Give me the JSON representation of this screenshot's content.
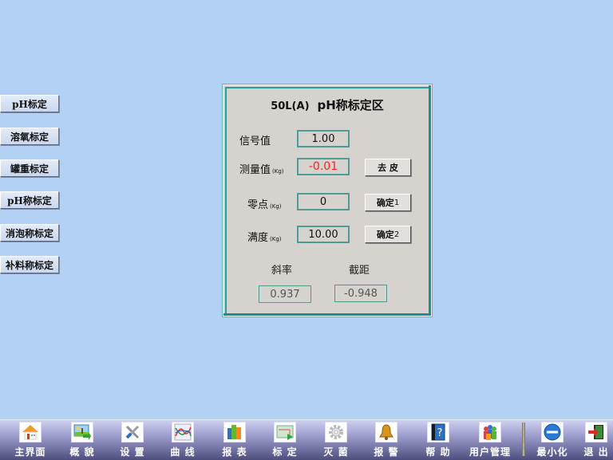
{
  "sidebar": {
    "items": [
      {
        "label": "pH标定"
      },
      {
        "label": "溶氧标定"
      },
      {
        "label": "罐重标定"
      },
      {
        "label": "pH称标定"
      },
      {
        "label": "消泡称标定"
      },
      {
        "label": "补料称标定"
      }
    ]
  },
  "panel": {
    "model": "50L(A)",
    "title": "pH称标定区",
    "signal_label": "信号值",
    "signal_value": "1.00",
    "measure_label": "测量值",
    "measure_unit": "(Kg)",
    "measure_value": "-0.01",
    "tare_button": "去 皮",
    "zero_label": "零点",
    "zero_unit": "(Kg)",
    "zero_value": "0",
    "confirm1_label": "确定",
    "confirm1_num": "1",
    "full_label": "满度",
    "full_unit": "(Kg)",
    "full_value": "10.00",
    "confirm2_label": "确定",
    "confirm2_num": "2",
    "slope_label": "斜率",
    "slope_value": "0.937",
    "intercept_label": "截距",
    "intercept_value": "-0.948",
    "colors": {
      "accent_border": "#20a29d",
      "measure_value": "#ff2020"
    }
  },
  "toolbar": {
    "items": [
      {
        "label": "主界面",
        "icon": "home-icon"
      },
      {
        "label": "概 貌",
        "icon": "overview-icon"
      },
      {
        "label": "设 置",
        "icon": "settings-tools-icon"
      },
      {
        "label": "曲 线",
        "icon": "curve-chart-icon"
      },
      {
        "label": "报 表",
        "icon": "report-icon"
      },
      {
        "label": "标 定",
        "icon": "calibration-icon"
      },
      {
        "label": "灭 菌",
        "icon": "gear-icon"
      },
      {
        "label": "报 警",
        "icon": "bell-icon"
      },
      {
        "label": "帮 助",
        "icon": "help-book-icon"
      },
      {
        "label": "用户管理",
        "icon": "users-icon"
      },
      {
        "label": "最小化",
        "icon": "minimize-icon"
      },
      {
        "label": "退 出",
        "icon": "exit-door-icon"
      }
    ]
  }
}
